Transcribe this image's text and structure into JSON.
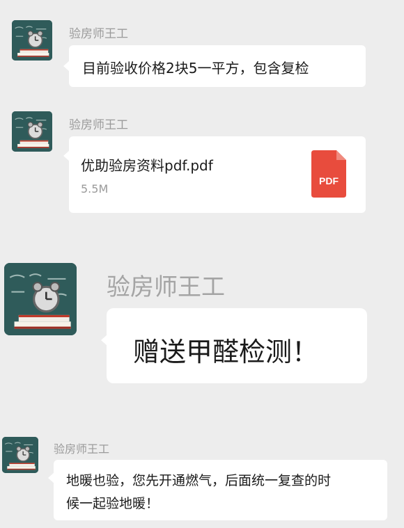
{
  "messages": [
    {
      "sender": "验房师王工",
      "text": "目前验收价格2块5一平方，包含复检"
    },
    {
      "sender": "验房师王工",
      "file": {
        "name": "优助验房资料pdf.pdf",
        "size": "5.5M",
        "type_label": "PDF"
      }
    },
    {
      "sender": "验房师王工",
      "text": "赠送甲醛检测！"
    },
    {
      "sender": "验房师王工",
      "text_lines": [
        "地暖也验，您先开通燃气，后面统一复查的时",
        "候一起验地暖！"
      ]
    }
  ],
  "colors": {
    "background": "#ededed",
    "bubble": "#ffffff",
    "sender_name": "#9a9a9a",
    "pdf_icon": "#e84c3d",
    "avatar_board": "#2f5b5a"
  },
  "icons": {
    "avatar": "teacher-avatar-icon",
    "file": "pdf-file-icon"
  }
}
